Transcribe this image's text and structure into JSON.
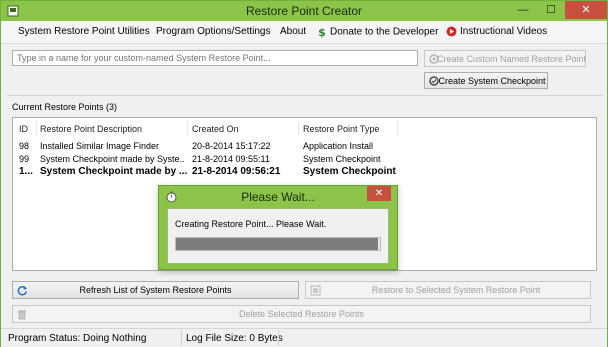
{
  "window": {
    "title": "Restore Point Creator",
    "minimize_glyph": "—",
    "maximize_glyph": "☐",
    "close_glyph": "✕"
  },
  "menu": {
    "items": [
      {
        "label": "System Restore Point Utilities"
      },
      {
        "label": "Program Options/Settings"
      },
      {
        "label": "About"
      },
      {
        "label": "Donate to the Developer",
        "icon": "dollar-icon"
      },
      {
        "label": "Instructional Videos",
        "icon": "video-play-icon"
      }
    ]
  },
  "naming": {
    "placeholder": "Type in a name for your custom-named System Restore Point...",
    "create_custom_label": "Create Custom Named Restore Point",
    "create_checkpoint_label": "Create System Checkpoint"
  },
  "restore_points": {
    "section_label": "Current Restore Points (3)",
    "columns": [
      "ID",
      "Restore Point Description",
      "Created On",
      "Restore Point Type"
    ],
    "rows": [
      {
        "id": "98",
        "description": "Installed Similar Image Finder",
        "created_on": "20-8-2014 15:17:22",
        "type": "Application Install",
        "bold": false
      },
      {
        "id": "99",
        "description": "System Checkpoint made by Syste...",
        "created_on": "21-8-2014 09:55:11",
        "type": "System Checkpoint",
        "bold": false
      },
      {
        "id": "1...",
        "description": "System Checkpoint made by ...",
        "created_on": "21-8-2014 09:56:21",
        "type": "System Checkpoint",
        "bold": true
      }
    ]
  },
  "dialog": {
    "title": "Please Wait...",
    "message": "Creating Restore Point... Please Wait.",
    "close_glyph": "✕",
    "progress_fraction": 0.99
  },
  "actions": {
    "refresh_label": "Refresh List of System Restore Points",
    "restore_label": "Restore to Selected System Restore Point",
    "delete_label": "Delete Selected Restore Points"
  },
  "status": {
    "program_status": "Program Status:  Doing Nothing",
    "log_size": "Log File Size:  0 Bytes"
  },
  "colors": {
    "titlebar": "#8cc44a",
    "close_button": "#c7503e",
    "progress_fill": "#7d7d7d"
  }
}
